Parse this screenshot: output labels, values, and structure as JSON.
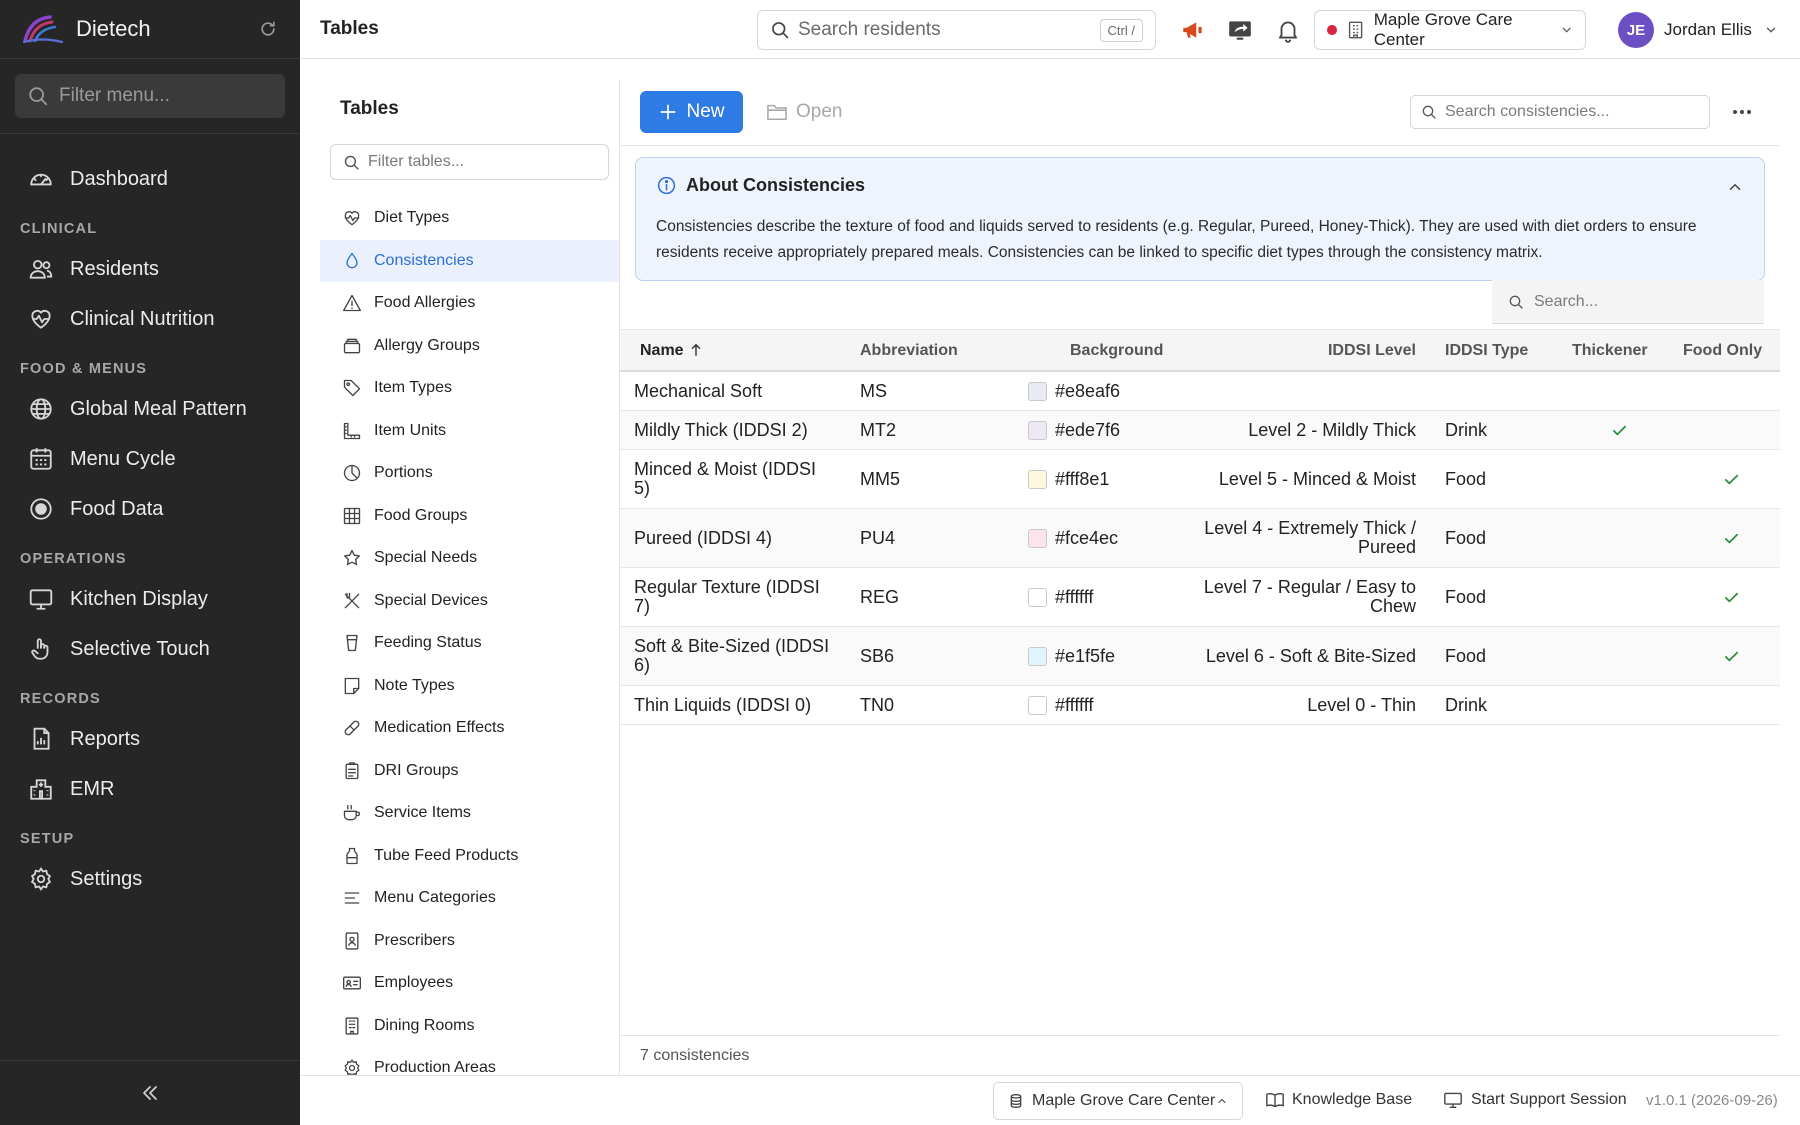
{
  "brand": {
    "name": "Dietech"
  },
  "nav": {
    "filter_placeholder": "Filter menu...",
    "dashboard": "Dashboard",
    "sections": [
      {
        "label": "CLINICAL",
        "items": [
          "Residents",
          "Clinical Nutrition"
        ]
      },
      {
        "label": "FOOD & MENUS",
        "items": [
          "Global Meal Pattern",
          "Menu Cycle",
          "Food Data"
        ]
      },
      {
        "label": "OPERATIONS",
        "items": [
          "Kitchen Display",
          "Selective Touch"
        ]
      },
      {
        "label": "RECORDS",
        "items": [
          "Reports",
          "EMR"
        ]
      },
      {
        "label": "SETUP",
        "items": [
          "Settings"
        ]
      }
    ]
  },
  "header": {
    "title": "Tables",
    "search_placeholder": "Search residents",
    "search_shortcut": "Ctrl /",
    "facility": "Maple Grove Care Center",
    "user": {
      "initials": "JE",
      "name": "Jordan Ellis"
    }
  },
  "tables_panel": {
    "title": "Tables",
    "filter_placeholder": "Filter tables...",
    "active": "Consistencies",
    "items": [
      "Diet Types",
      "Consistencies",
      "Food Allergies",
      "Allergy Groups",
      "Item Types",
      "Item Units",
      "Portions",
      "Food Groups",
      "Special Needs",
      "Special Devices",
      "Feeding Status",
      "Note Types",
      "Medication Effects",
      "DRI Groups",
      "Service Items",
      "Tube Feed Products",
      "Menu Categories",
      "Prescribers",
      "Employees",
      "Dining Rooms",
      "Production Areas"
    ]
  },
  "toolbar": {
    "new_label": "New",
    "open_label": "Open",
    "search_placeholder": "Search consistencies..."
  },
  "info": {
    "title": "About Consistencies",
    "text": "Consistencies describe the texture of food and liquids served to residents (e.g. Regular, Pureed, Honey-Thick). They are used with diet orders to ensure residents receive appropriately prepared meals. Consistencies can be linked to specific diet types through the consistency matrix."
  },
  "grid": {
    "search_placeholder": "Search...",
    "columns": {
      "name": "Name",
      "abbreviation": "Abbreviation",
      "background": "Background",
      "iddsi_level": "IDDSI Level",
      "iddsi_type": "IDDSI Type",
      "thickener": "Thickener",
      "food_only": "Food Only"
    },
    "rows": [
      {
        "name": "Mechanical Soft",
        "abbreviation": "MS",
        "background": "#e8eaf6",
        "iddsi_level": "",
        "iddsi_type": "",
        "thickener": false,
        "food_only": false
      },
      {
        "name": "Mildly Thick (IDDSI 2)",
        "abbreviation": "MT2",
        "background": "#ede7f6",
        "iddsi_level": "Level 2 - Mildly Thick",
        "iddsi_type": "Drink",
        "thickener": true,
        "food_only": false
      },
      {
        "name": "Minced & Moist (IDDSI 5)",
        "abbreviation": "MM5",
        "background": "#fff8e1",
        "iddsi_level": "Level 5 - Minced & Moist",
        "iddsi_type": "Food",
        "thickener": false,
        "food_only": true
      },
      {
        "name": "Pureed (IDDSI 4)",
        "abbreviation": "PU4",
        "background": "#fce4ec",
        "iddsi_level": "Level 4 - Extremely Thick / Pureed",
        "iddsi_type": "Food",
        "thickener": false,
        "food_only": true
      },
      {
        "name": "Regular Texture (IDDSI 7)",
        "abbreviation": "REG",
        "background": "#ffffff",
        "iddsi_level": "Level 7 - Regular / Easy to Chew",
        "iddsi_type": "Food",
        "thickener": false,
        "food_only": true
      },
      {
        "name": "Soft & Bite-Sized (IDDSI 6)",
        "abbreviation": "SB6",
        "background": "#e1f5fe",
        "iddsi_level": "Level 6 - Soft & Bite-Sized",
        "iddsi_type": "Food",
        "thickener": false,
        "food_only": true
      },
      {
        "name": "Thin Liquids (IDDSI 0)",
        "abbreviation": "TN0",
        "background": "#ffffff",
        "iddsi_level": "Level 0 - Thin",
        "iddsi_type": "Drink",
        "thickener": false,
        "food_only": false
      }
    ],
    "count_label": "7 consistencies"
  },
  "status_bar": {
    "facility": "Maple Grove Care Center",
    "knowledge_base": "Knowledge Base",
    "support": "Start Support Session",
    "version": "v1.0.1 (2026-09-26)"
  },
  "colors": {
    "accent": "#2f7be5",
    "nav_bg": "#262626",
    "status_dot": "#d7263d",
    "check": "#2b8a3e",
    "info_bg": "#edf4fc"
  }
}
